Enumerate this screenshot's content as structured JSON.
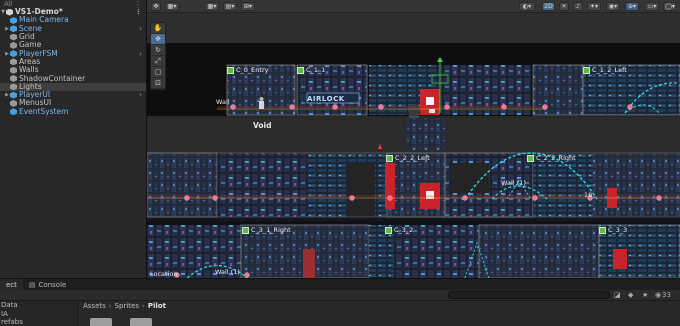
{
  "hierarchy": {
    "header": "All",
    "scene_name": "VS1-Demo*",
    "items": [
      {
        "label": "Main Camera",
        "icon": "cube-blue-icon",
        "depth": 1,
        "color": "blue",
        "caret": ""
      },
      {
        "label": "Scene",
        "icon": "cube-blue-icon",
        "depth": 1,
        "color": "blue",
        "caret": "▶",
        "arrow": true
      },
      {
        "label": "Grid",
        "icon": "cube-gray-icon",
        "depth": 1,
        "color": "gray",
        "caret": ""
      },
      {
        "label": "Game",
        "icon": "cube-gray-icon",
        "depth": 1,
        "color": "gray",
        "caret": ""
      },
      {
        "label": "PlayerFSM",
        "icon": "cube-blue-icon",
        "depth": 1,
        "color": "blue",
        "caret": "▶",
        "arrow": true
      },
      {
        "label": "Areas",
        "icon": "cube-gray-icon",
        "depth": 1,
        "color": "gray",
        "caret": ""
      },
      {
        "label": "Walls",
        "icon": "cube-gray-icon",
        "depth": 1,
        "color": "gray",
        "caret": ""
      },
      {
        "label": "ShadowContainer",
        "icon": "cube-gray-icon",
        "depth": 1,
        "color": "gray",
        "caret": ""
      },
      {
        "label": "Lights",
        "icon": "cube-gray-icon",
        "depth": 1,
        "color": "gray",
        "caret": "",
        "selected": true
      },
      {
        "label": "PlayerUI",
        "icon": "cube-blue-icon",
        "depth": 1,
        "color": "blue",
        "caret": "▶",
        "arrow": true
      },
      {
        "label": "MenusUI",
        "icon": "cube-gray-icon",
        "depth": 1,
        "color": "gray",
        "caret": ""
      },
      {
        "label": "EventSystem",
        "icon": "cube-blue-icon",
        "depth": 1,
        "color": "blue",
        "caret": ""
      }
    ]
  },
  "scene_toolbar": {
    "mode_2d": "2D"
  },
  "scene_view": {
    "labels": {
      "void": "Void",
      "airlock": "AIRLOCK",
      "wall_1": "Wall",
      "wall_2": "Wall (1)",
      "wall_3": "Wall (1)",
      "location": "Location",
      "num_18": "18"
    },
    "rooms": [
      "C_0_Entry",
      "C_1_1",
      "C_1_2_Left",
      "C_2_2_Left",
      "C_2_2_Right",
      "C_3_1_Right",
      "C_3_2",
      "C_3_3"
    ]
  },
  "bottom": {
    "tabs": [
      "ect",
      "Console"
    ],
    "project_items": [
      "Data",
      "IA",
      "refabs"
    ],
    "breadcrumb": [
      "Assets",
      "Sprites",
      "Pilot"
    ],
    "hidden_count": "33"
  },
  "colors": {
    "accent_blue": "#4a9eda",
    "room_green": "#5dbb4a",
    "cyan_beam": "#2fd6e0",
    "red_door": "#c9242b"
  }
}
